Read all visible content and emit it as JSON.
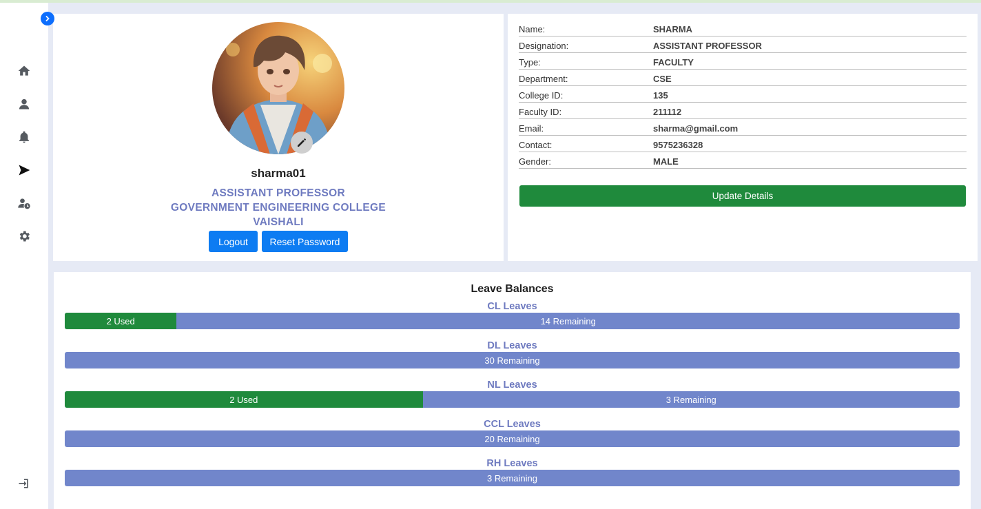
{
  "profile": {
    "username": "sharma01",
    "designation": "ASSISTANT PROFESSOR",
    "college_line1": "GOVERNMENT ENGINEERING COLLEGE",
    "college_line2": "VAISHALI",
    "logout_label": "Logout",
    "reset_label": "Reset Password"
  },
  "details": {
    "rows": [
      {
        "label": "Name:",
        "value": "SHARMA"
      },
      {
        "label": "Designation:",
        "value": "ASSISTANT PROFESSOR"
      },
      {
        "label": "Type:",
        "value": "FACULTY"
      },
      {
        "label": "Department:",
        "value": "CSE"
      },
      {
        "label": "College ID:",
        "value": "135"
      },
      {
        "label": "Faculty ID:",
        "value": "211112"
      },
      {
        "label": "Email:",
        "value": "sharma@gmail.com"
      },
      {
        "label": "Contact:",
        "value": "9575236328"
      },
      {
        "label": "Gender:",
        "value": "MALE"
      }
    ],
    "update_label": "Update Details"
  },
  "leaves": {
    "title": "Leave Balances",
    "items": [
      {
        "name": "CL Leaves",
        "used_label": "2 Used",
        "remaining_label": "14 Remaining",
        "used_fraction": 0.125
      },
      {
        "name": "DL Leaves",
        "used_label": "",
        "remaining_label": "30 Remaining",
        "used_fraction": 0
      },
      {
        "name": "NL Leaves",
        "used_label": "2 Used",
        "remaining_label": "3 Remaining",
        "used_fraction": 0.4
      },
      {
        "name": "CCL Leaves",
        "used_label": "",
        "remaining_label": "20 Remaining",
        "used_fraction": 0
      },
      {
        "name": "RH Leaves",
        "used_label": "",
        "remaining_label": "3 Remaining",
        "used_fraction": 0
      }
    ]
  },
  "sidebar": {
    "icons": [
      "home-icon",
      "user-icon",
      "bell-icon",
      "send-icon",
      "user-clock-icon",
      "gear-icon",
      "logout-icon"
    ],
    "active": "send-icon"
  },
  "colors": {
    "accent_blue": "#0d7cf2",
    "success_green": "#1f8a3c",
    "remaining_bar": "#7186cb",
    "subtitle_text": "#6f7bc0",
    "page_bg": "#e6eaf5"
  }
}
